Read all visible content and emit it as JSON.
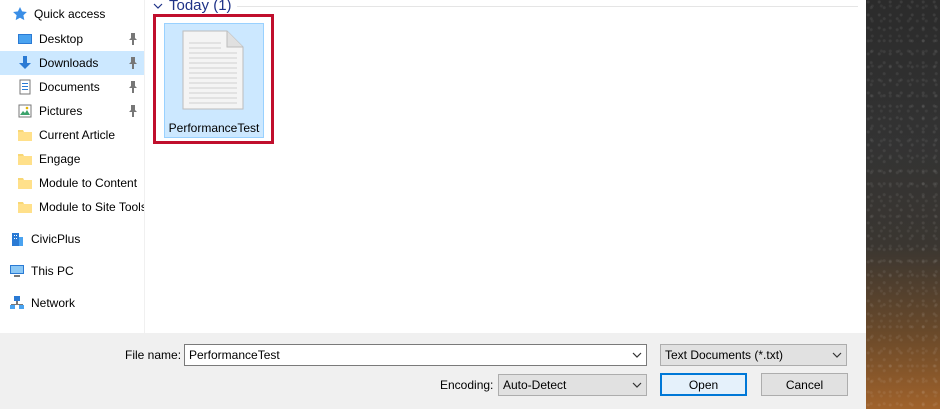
{
  "navigation": {
    "items": [
      {
        "label": "Quick access",
        "icon": "star-icon",
        "pinned": false
      },
      {
        "label": "Desktop",
        "icon": "desktop-icon",
        "pinned": true
      },
      {
        "label": "Downloads",
        "icon": "download-arrow-icon",
        "pinned": true,
        "selected": true
      },
      {
        "label": "Documents",
        "icon": "documents-icon",
        "pinned": true
      },
      {
        "label": "Pictures",
        "icon": "pictures-icon",
        "pinned": true
      },
      {
        "label": "Current Article",
        "icon": "folder-icon",
        "pinned": false
      },
      {
        "label": "Engage",
        "icon": "folder-icon",
        "pinned": false
      },
      {
        "label": "Module to Content",
        "icon": "folder-icon",
        "pinned": false
      },
      {
        "label": "Module to Site Tools",
        "icon": "folder-icon",
        "pinned": false
      },
      {
        "label": "CivicPlus",
        "icon": "building-icon",
        "pinned": false
      },
      {
        "label": "This PC",
        "icon": "computer-icon",
        "pinned": false
      },
      {
        "label": "Network",
        "icon": "network-icon",
        "pinned": false
      }
    ]
  },
  "content": {
    "group_header": "Today (1)",
    "files": [
      {
        "name": "PerformanceTest",
        "icon": "text-file-icon",
        "selected": true
      }
    ]
  },
  "footer": {
    "file_name_label": "File name:",
    "file_name_value": "PerformanceTest",
    "file_type_value": "Text Documents (*.txt)",
    "encoding_label": "Encoding:",
    "encoding_value": "Auto-Detect",
    "open_button": "Open",
    "cancel_button": "Cancel"
  },
  "colors": {
    "selection": "#cce8ff",
    "highlight_border": "#c00f2d",
    "header_text": "#1e3287",
    "primary_button_border": "#0078d7"
  }
}
